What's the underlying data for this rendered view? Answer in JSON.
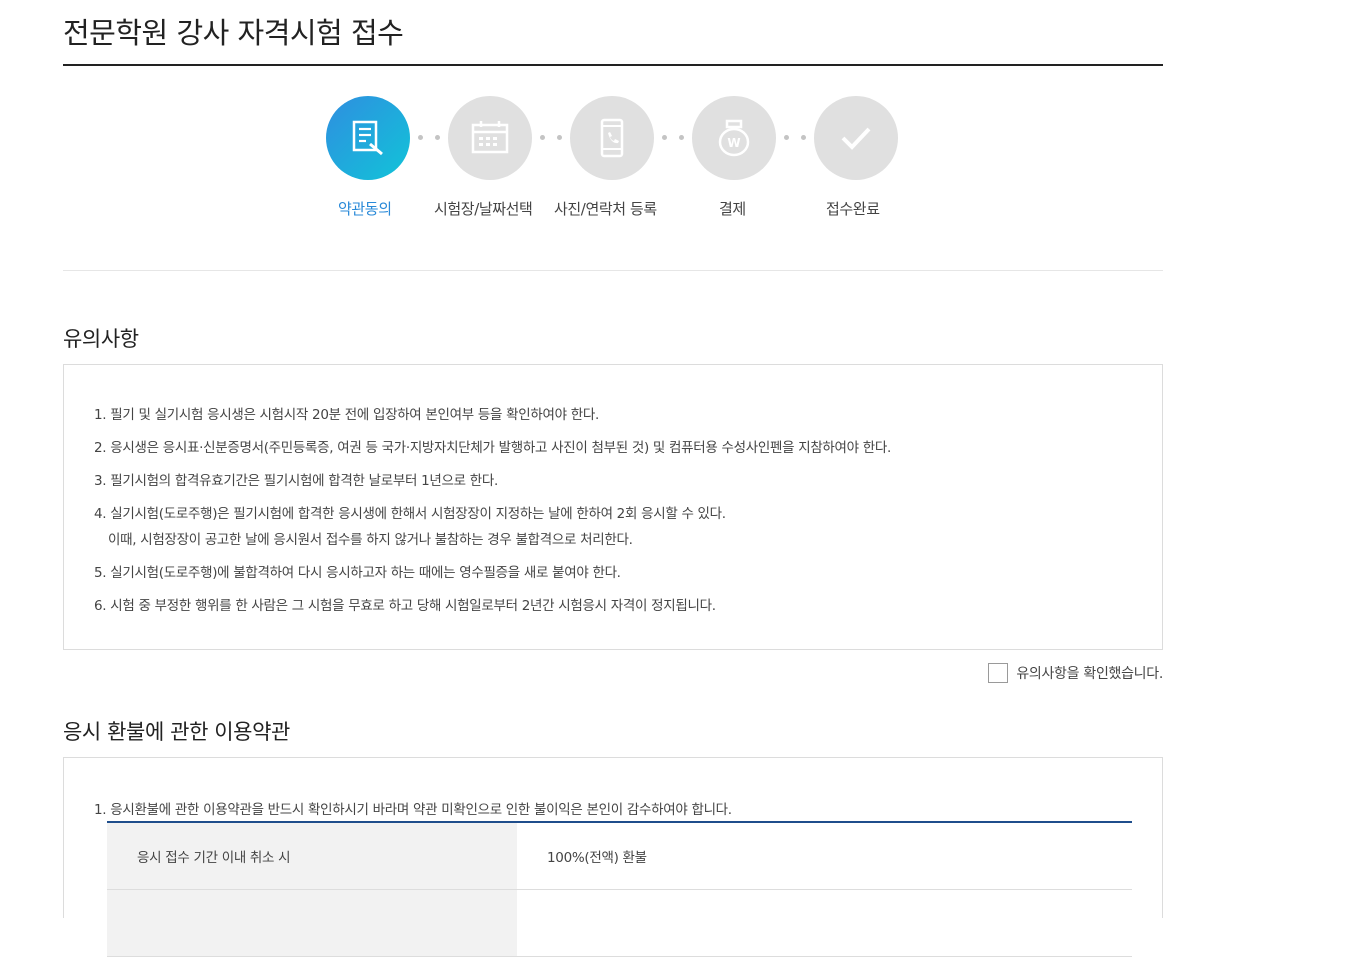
{
  "page": {
    "title": "전문학원 강사 자격시험 접수"
  },
  "steps": [
    {
      "label": "약관동의",
      "icon": "document-pen-icon",
      "active": true
    },
    {
      "label": "시험장/날짜선택",
      "icon": "calendar-icon",
      "active": false
    },
    {
      "label": "사진/연락처 등록",
      "icon": "phone-icon",
      "active": false
    },
    {
      "label": "결제",
      "icon": "won-bag-icon",
      "active": false
    },
    {
      "label": "접수완료",
      "icon": "check-icon",
      "active": false
    }
  ],
  "notice": {
    "title": "유의사항",
    "items": [
      "1. 필기 및 실기시험 응시생은 시험시작 20분 전에 입장하여 본인여부 등을 확인하여야 한다.",
      "2. 응시생은 응시표·신분증명서(주민등록증, 여권 등 국가·지방자치단체가 발행하고 사진이 첨부된 것) 및 컴퓨터용 수성사인펜을 지참하여야 한다.",
      "3. 필기시험의 합격유효기간은 필기시험에 합격한 날로부터 1년으로 한다.",
      "4. 실기시험(도로주행)은 필기시험에 합격한 응시생에 한해서 시험장장이 지정하는 날에 한하여 2회 응시할 수 있다.",
      "5. 실기시험(도로주행)에 불합격하여 다시 응시하고자 하는 때에는 영수필증을 새로 붙여야 한다.",
      "6. 시험 중 부정한 행위를 한 사람은 그 시험을 무효로 하고 당해 시험일로부터 2년간 시험응시 자격이 정지됩니다."
    ],
    "item4_sub": "이때, 시험장장이 공고한 날에 응시원서 접수를 하지 않거나 불참하는 경우 불합격으로 처리한다.",
    "confirm_label": "유의사항을 확인했습니다."
  },
  "refund": {
    "title": "응시 환불에 관한 이용약관",
    "intro": "1. 응시환불에 관한 이용약관을 반드시 확인하시기 바라며 약관 미확인으로 인한 불이익은 본인이 감수하여야 합니다.",
    "rows": [
      {
        "condition": "응시 접수 기간 이내 취소 시",
        "refund": "100%(전액) 환불"
      }
    ]
  },
  "colors": {
    "accent": "#2a8ad8",
    "table_border": "#1f4e8c"
  }
}
